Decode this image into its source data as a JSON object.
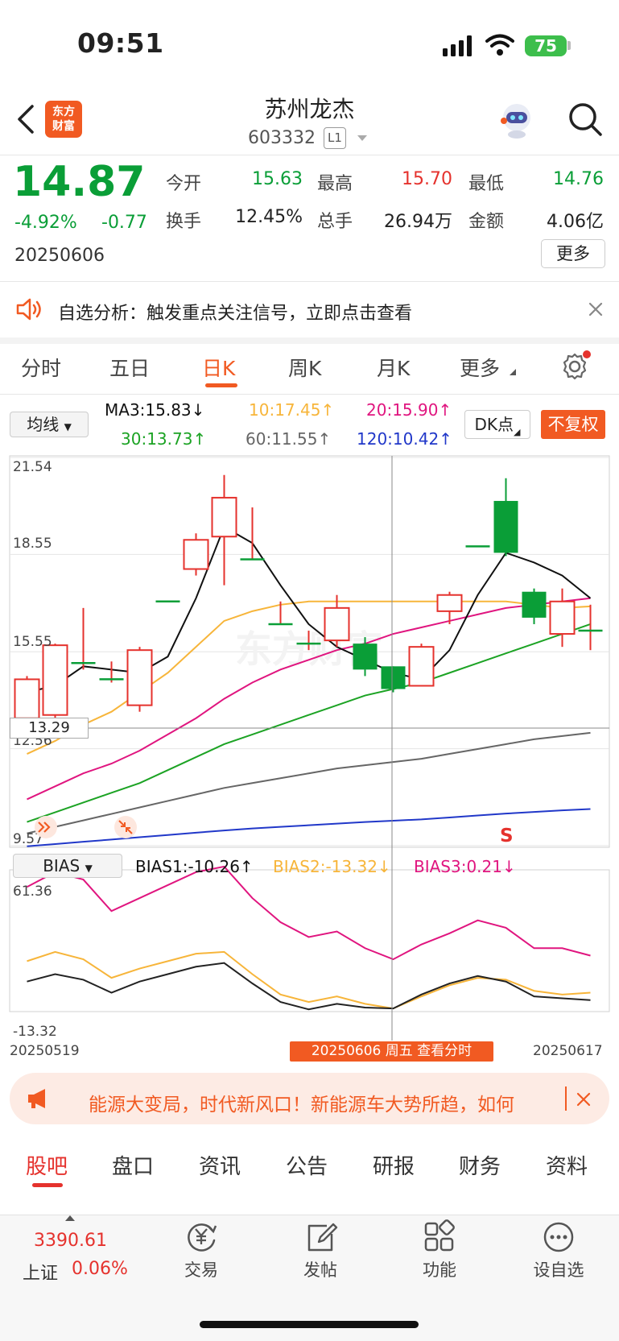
{
  "status": {
    "time": "09:51",
    "battery": "75"
  },
  "header": {
    "logo_line1": "东方",
    "logo_line2": "财富",
    "title": "苏州龙杰",
    "code": "603332",
    "level": "L1"
  },
  "quote": {
    "price": "14.87",
    "change_pct": "-4.92%",
    "change": "-0.77",
    "date": "20250606",
    "open_label": "今开",
    "open": "15.63",
    "high_label": "最高",
    "high": "15.70",
    "low_label": "最低",
    "low": "14.76",
    "turnover_label": "换手",
    "turnover": "12.45%",
    "volume_label": "总手",
    "volume": "26.94万",
    "amount_label": "金额",
    "amount": "4.06亿",
    "more": "更多"
  },
  "notice": {
    "text": "自选分析：触发重点关注信号，立即点击查看"
  },
  "period_tabs": [
    "分时",
    "五日",
    "日K",
    "周K",
    "月K",
    "更多"
  ],
  "active_period": 2,
  "ma_bar": {
    "selector": "均线",
    "ma3": "MA3:15.83↓",
    "ma10": "10:17.45↑",
    "ma20": "20:15.90↑",
    "ma30": "30:13.73↑",
    "ma60": "60:11.55↑",
    "ma120": "120:10.42↑",
    "dk": "DK点",
    "fq": "不复权"
  },
  "colors": {
    "up": "#e5322d",
    "down": "#0a9e37",
    "ma3": "#111111",
    "ma10": "#f7b53a",
    "ma20": "#e0157f",
    "ma30": "#1ca324",
    "ma60": "#666666",
    "ma120": "#2138c9",
    "accent": "#f15a22"
  },
  "chart_data": {
    "type": "candlestick",
    "price_axis": {
      "ticks": [
        "21.54",
        "18.55",
        "15.55",
        "12.56",
        "9.57"
      ],
      "ylim": [
        9.57,
        21.54
      ],
      "crosshair_value": "13.29"
    },
    "x_range": [
      "20250519",
      "20250617"
    ],
    "selected": "20250606 周五 查看分时",
    "sell_marker": "S",
    "candles": [
      {
        "o": 13.5,
        "c": 14.7,
        "h": 14.8,
        "l": 13.3
      },
      {
        "o": 13.6,
        "c": 15.75,
        "h": 15.8,
        "l": 13.5
      },
      {
        "o": 15.2,
        "c": 15.2,
        "h": 16.9,
        "l": 15.0
      },
      {
        "o": 14.7,
        "c": 14.7,
        "h": 15.25,
        "l": 14.6
      },
      {
        "o": 13.9,
        "c": 15.6,
        "h": 15.7,
        "l": 13.7
      },
      {
        "o": 17.1,
        "c": 17.1,
        "h": 17.1,
        "l": 17.1
      },
      {
        "o": 18.1,
        "c": 19.0,
        "h": 19.2,
        "l": 17.9
      },
      {
        "o": 19.1,
        "c": 20.3,
        "h": 21.0,
        "l": 17.6
      },
      {
        "o": 18.4,
        "c": 18.4,
        "h": 20.0,
        "l": 18.4
      },
      {
        "o": 16.4,
        "c": 16.4,
        "h": 17.1,
        "l": 16.4
      },
      {
        "o": 15.8,
        "c": 15.8,
        "h": 16.2,
        "l": 15.6
      },
      {
        "o": 15.9,
        "c": 16.9,
        "h": 17.3,
        "l": 15.7
      },
      {
        "o": 15.8,
        "c": 15.0,
        "h": 16.0,
        "l": 14.8
      },
      {
        "o": 15.1,
        "c": 14.4,
        "h": 15.1,
        "l": 14.3
      },
      {
        "o": 14.5,
        "c": 15.7,
        "h": 15.8,
        "l": 14.5
      },
      {
        "o": 16.8,
        "c": 17.3,
        "h": 17.4,
        "l": 16.4
      },
      {
        "o": 18.8,
        "c": 18.8,
        "h": 18.8,
        "l": 18.8
      },
      {
        "o": 20.2,
        "c": 18.6,
        "h": 20.9,
        "l": 18.5
      },
      {
        "o": 17.4,
        "c": 16.6,
        "h": 17.5,
        "l": 16.4
      },
      {
        "o": 16.1,
        "c": 17.1,
        "h": 17.5,
        "l": 15.7
      },
      {
        "o": 16.2,
        "c": 16.2,
        "h": 17.0,
        "l": 15.6
      }
    ],
    "ma": {
      "ma3": [
        14.3,
        14.5,
        15.1,
        15.0,
        14.9,
        15.4,
        17.2,
        19.4,
        18.9,
        17.6,
        16.4,
        15.7,
        15.3,
        14.9,
        14.7,
        15.6,
        17.3,
        18.6,
        18.3,
        17.9,
        17.2
      ],
      "ma10": [
        12.4,
        12.8,
        13.3,
        13.7,
        14.3,
        14.9,
        15.7,
        16.5,
        16.8,
        17.0,
        17.1,
        17.1,
        17.1,
        17.1,
        17.1,
        17.1,
        17.1,
        17.1,
        17.0,
        16.9,
        16.95
      ],
      "ma20": [
        11.0,
        11.4,
        11.8,
        12.1,
        12.5,
        13.0,
        13.5,
        14.1,
        14.6,
        15.0,
        15.3,
        15.6,
        15.8,
        16.1,
        16.3,
        16.5,
        16.7,
        16.9,
        17.0,
        17.1,
        17.2
      ],
      "ma30": [
        10.3,
        10.6,
        10.9,
        11.2,
        11.5,
        11.9,
        12.3,
        12.7,
        13.0,
        13.3,
        13.6,
        13.9,
        14.2,
        14.4,
        14.6,
        14.9,
        15.2,
        15.5,
        15.8,
        16.1,
        16.4
      ],
      "ma60": [
        9.95,
        10.15,
        10.35,
        10.55,
        10.75,
        10.95,
        11.15,
        11.35,
        11.5,
        11.65,
        11.8,
        11.95,
        12.05,
        12.15,
        12.25,
        12.4,
        12.55,
        12.7,
        12.85,
        12.95,
        13.05
      ],
      "ma120": [
        9.55,
        9.62,
        9.69,
        9.76,
        9.83,
        9.9,
        9.97,
        10.04,
        10.1,
        10.15,
        10.2,
        10.25,
        10.3,
        10.34,
        10.38,
        10.44,
        10.5,
        10.56,
        10.61,
        10.66,
        10.7
      ]
    },
    "bias": {
      "selector": "BIAS",
      "bias1": "BIAS1:-10.26↑",
      "bias2": "BIAS2:-13.32↓",
      "bias3": "BIAS3:0.21↓",
      "ticks": [
        "61.36",
        "-13.32"
      ],
      "ylim": [
        -13.32,
        61.36
      ],
      "bias1_series": [
        2,
        6,
        3,
        -4,
        2,
        6,
        10,
        12,
        1,
        -9,
        -13,
        -10,
        -12,
        -12.5,
        -5,
        1,
        5,
        2,
        -6,
        -7,
        -8
      ],
      "bias2_series": [
        13,
        18,
        14,
        4,
        9,
        13,
        17,
        18,
        6,
        -5,
        -9,
        -6,
        -10,
        -12.5,
        -6,
        0,
        4,
        3,
        -3,
        -5,
        -4
      ],
      "bias3_series": [
        53,
        61,
        57,
        40,
        47,
        54,
        61,
        64,
        47,
        34,
        26,
        29,
        20,
        14,
        22,
        28,
        35,
        31,
        20,
        20,
        16
      ]
    }
  },
  "ad": {
    "text": "能源大变局，时代新风口！新能源车大势所趋，如何"
  },
  "bottom_tabs": [
    "股吧",
    "盘口",
    "资讯",
    "公告",
    "研报",
    "财务",
    "资料"
  ],
  "active_bottom": 0,
  "nav": {
    "index_value": "3390.61",
    "index_name": "上证",
    "index_change": "0.06%",
    "trade": "交易",
    "post": "发帖",
    "func": "功能",
    "watch": "设自选"
  }
}
